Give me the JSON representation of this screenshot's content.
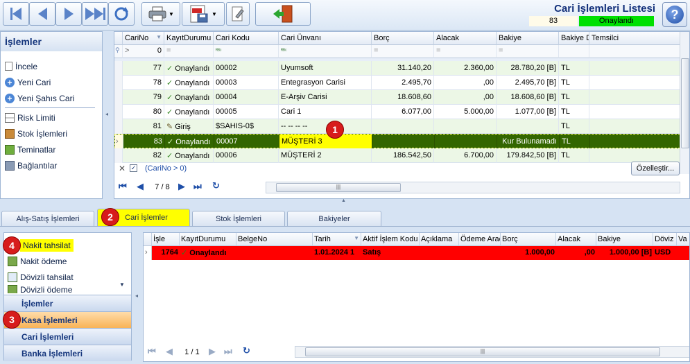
{
  "header": {
    "title": "Cari İşlemleri Listesi",
    "record_id": "83",
    "status": "Onaylandı",
    "status_color": "#00e000"
  },
  "toolbar": {
    "icons": [
      "first-record-icon",
      "previous-record-icon",
      "next-record-icon",
      "last-record-icon",
      "refresh-icon",
      "print-icon",
      "export-pdf-icon",
      "settings-icon",
      "exit-icon",
      "help-icon"
    ]
  },
  "left_panel": {
    "title": "İşlemler",
    "items": [
      "İncele",
      "Yeni Cari",
      "Yeni Şahıs Cari",
      "Risk Limiti",
      "Stok İşlemleri",
      "Teminatlar",
      "Bağlantılar"
    ]
  },
  "grid": {
    "columns": [
      "CariNo",
      "KayıtDurumu",
      "Cari Kodu",
      "Cari Ünvanı",
      "Borç",
      "Alacak",
      "Bakiye",
      "Bakiye D",
      "Temsilci"
    ],
    "filter": {
      "cari_no": "0",
      "op": "="
    },
    "rows": [
      {
        "cari_no": "77",
        "status": "Onaylandı",
        "code": "00002",
        "name": "Uyumsoft",
        "borc": "31.140,20",
        "alacak": "2.360,00",
        "bakiye": "28.780,20 [B]",
        "doviz": "TL"
      },
      {
        "cari_no": "78",
        "status": "Onaylandı",
        "code": "00003",
        "name": "Entegrasyon Carisi",
        "borc": "2.495,70",
        "alacak": ",00",
        "bakiye": "2.495,70 [B]",
        "doviz": "TL"
      },
      {
        "cari_no": "79",
        "status": "Onaylandı",
        "code": "00004",
        "name": "E-Arşiv Carisi",
        "borc": "18.608,60",
        "alacak": ",00",
        "bakiye": "18.608,60 [B]",
        "doviz": "TL"
      },
      {
        "cari_no": "80",
        "status": "Onaylandı",
        "code": "00005",
        "name": "Cari 1",
        "borc": "6.077,00",
        "alacak": "5.000,00",
        "bakiye": "1.077,00 [B]",
        "doviz": "TL"
      },
      {
        "cari_no": "81",
        "status": "Giriş",
        "code": "$SAHIS-0$",
        "name": "-- -- -- --",
        "borc": "",
        "alacak": "",
        "bakiye": "",
        "doviz": "TL"
      },
      {
        "cari_no": "83",
        "status": "Onaylandı",
        "code": "00007",
        "name": "MÜŞTERİ 3",
        "borc": "",
        "alacak": "",
        "bakiye": "Kur Bulunamadı",
        "doviz": "TL"
      },
      {
        "cari_no": "82",
        "status": "Onaylandı",
        "code": "00006",
        "name": "MÜŞTERİ 2",
        "borc": "186.542,50",
        "alacak": "6.700,00",
        "bakiye": "179.842,50 [B]",
        "doviz": "TL"
      }
    ],
    "filter_text": "(CariNo > 0)",
    "customize_label": "Özelleştir...",
    "pager": "7 / 8"
  },
  "tabs": [
    "Alış-Satış İşlemleri",
    "Cari İşlemler",
    "Stok İşlemleri",
    "Bakiyeler"
  ],
  "bottom_left": {
    "items": [
      "Nakit tahsilat",
      "Nakit ödeme",
      "Dövizli tahsilat",
      "Dövizli ödeme"
    ],
    "nav": [
      "İşlemler",
      "Kasa İşlemleri",
      "Cari İşlemleri",
      "Banka İşlemleri"
    ]
  },
  "bottom_grid": {
    "columns": [
      "İşle",
      "KayıtDurumu",
      "BelgeNo",
      "Tarih",
      "Aktif İşlem Kodu",
      "Açıklama",
      "Ödeme Aracı",
      "Borç",
      "Alacak",
      "Bakiye",
      "Döviz",
      "Va"
    ],
    "row": {
      "id": "1764",
      "status": "Onaylandı",
      "belge": "",
      "tarih": "1.01.2024 1",
      "kod": "Satış",
      "aciklama": "",
      "odeme": "",
      "borc": "1.000,00",
      "alacak": ",00",
      "bakiye": "1.000,00 [B]",
      "doviz": "USD"
    },
    "pager": "1 / 1"
  },
  "badges": [
    "1",
    "2",
    "3",
    "4"
  ]
}
